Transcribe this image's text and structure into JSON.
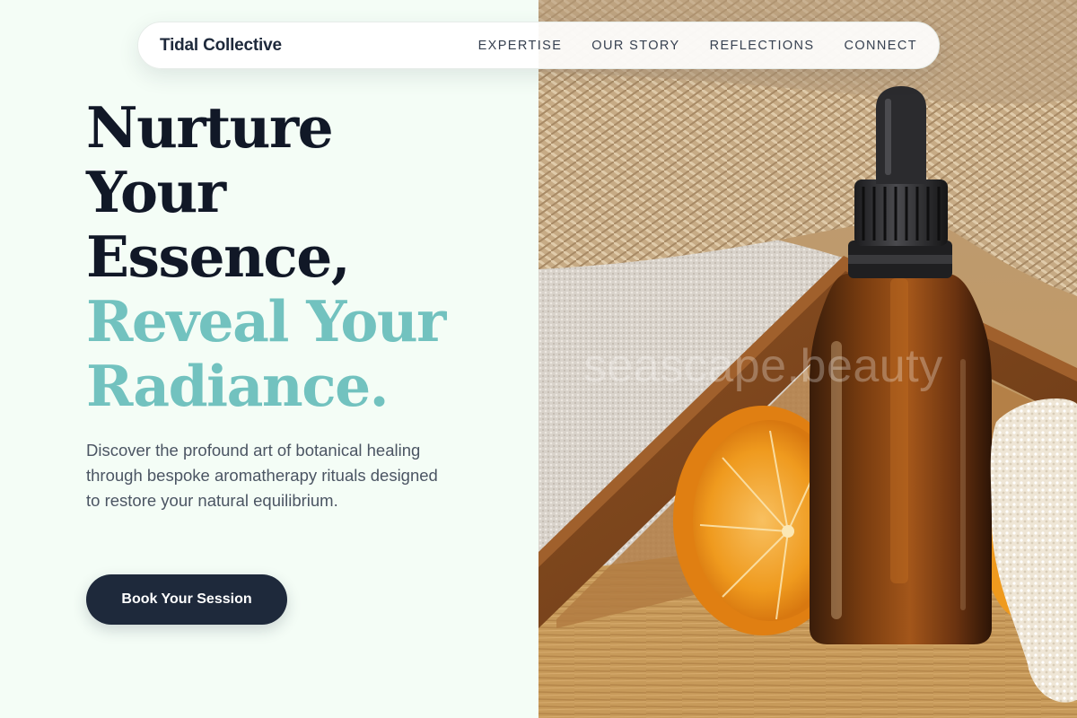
{
  "nav": {
    "brand": "Tidal Collective",
    "links": [
      "EXPERTISE",
      "OUR STORY",
      "REFLECTIONS",
      "CONNECT"
    ]
  },
  "hero": {
    "headline_dark": [
      "Nurture",
      "Your",
      "Essence,"
    ],
    "headline_accent": [
      "Reveal Your",
      "Radiance."
    ],
    "subtitle": "Discover the profound art of botanical healing through bespoke aromatherapy rituals designed to restore your natural equilibrium.",
    "cta_label": "Book Your Session",
    "image_watermark": "seascape.beauty"
  },
  "colors": {
    "background": "#f4fdf6",
    "heading": "#111827",
    "accent": "#72c2bf",
    "button": "#1e293b"
  }
}
